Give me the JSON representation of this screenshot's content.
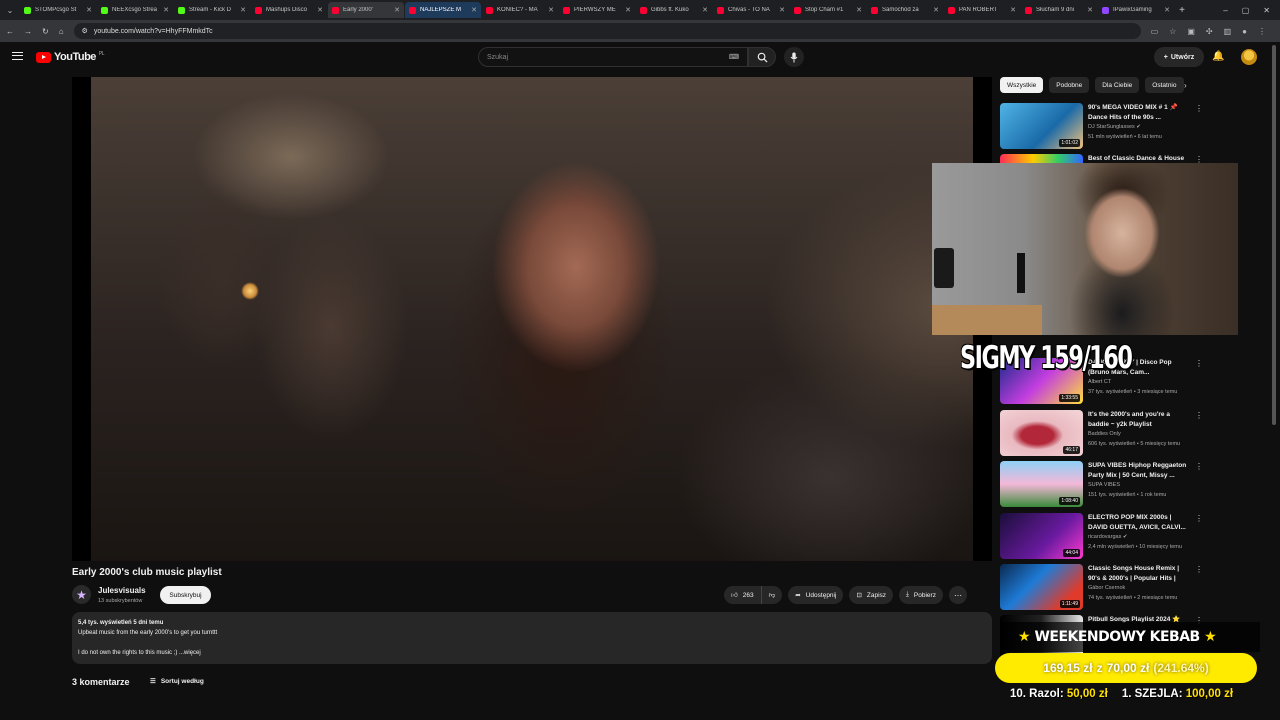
{
  "browser": {
    "tabs": [
      {
        "title": "STOMPcsgo St",
        "favicon_color": "#53fc18"
      },
      {
        "title": "NEEXcsgo Strea",
        "favicon_color": "#53fc18"
      },
      {
        "title": "Stream - Kick D",
        "favicon_color": "#53fc18"
      },
      {
        "title": "Mashups Disco",
        "favicon_color": "#ff0033"
      },
      {
        "title": "Early 2000'",
        "favicon_color": "#ff0033",
        "active": true
      },
      {
        "title": "NAJLEPSZE M",
        "favicon_color": "#ff0033",
        "highlight": true
      },
      {
        "title": "KONIEC? - MA",
        "favicon_color": "#ff0033"
      },
      {
        "title": "PIERWSZY ME",
        "favicon_color": "#ff0033"
      },
      {
        "title": "Gibbs ft. Kuko",
        "favicon_color": "#ff0033"
      },
      {
        "title": "Chivas - TO NA",
        "favicon_color": "#ff0033"
      },
      {
        "title": "Stop Cham #1",
        "favicon_color": "#ff0033"
      },
      {
        "title": "Samochód za",
        "favicon_color": "#ff0033"
      },
      {
        "title": "PAN ROBERT",
        "favicon_color": "#ff0033"
      },
      {
        "title": "Słucham 9 dni",
        "favicon_color": "#ff0033"
      },
      {
        "title": "IPawixGaming",
        "favicon_color": "#9146ff"
      }
    ],
    "url": "youtube.com/watch?v=HhyFFMmkdTc"
  },
  "youtube": {
    "logo_text": "YouTube",
    "logo_country": "PL",
    "search_placeholder": "Szukaj",
    "create_label": "Utwórz"
  },
  "video": {
    "title": "Early 2000's club music playlist",
    "channel_name": "Julesvisuals",
    "channel_subs": "13 subskrybentów",
    "subscribe_label": "Subskrybuj",
    "like_count": "263",
    "share_label": "Udostępnij",
    "save_label": "Zapisz",
    "download_label": "Pobierz",
    "description_stats": "5,4 tys. wyświetleń  5 dni temu",
    "description_line1": "Upbeat music from the early 2000's to get you turnttt",
    "description_line2": "I do not own the rights to this music ;) ...więcej",
    "comments_count": "3 komentarze",
    "sort_label": "Sortuj według"
  },
  "chips": [
    "Wszystkie",
    "Podobne",
    "Dla Ciebie",
    "Ostatnio"
  ],
  "recommendations": [
    {
      "title": "90's MEGA VIDEO MIX # 1 📌 Dance Hits of the 90s ...",
      "channel": "DJ StarSunglasses ✔",
      "meta": "51 mln wyświetleń • 6 lat temu",
      "duration": "1:01:02",
      "thumb": "thumb-a"
    },
    {
      "title": "Best of Classic Dance & House",
      "channel": "",
      "meta": "",
      "duration": "",
      "thumb": "thumb-b"
    },
    {
      "title": "DANCE PARTY | Disco Pop (Bruno Mars, Cam...",
      "channel": "Albert CT",
      "meta": "37 tys. wyświetleń • 3 miesiące temu",
      "duration": "1:33:55",
      "thumb": "thumb-d"
    },
    {
      "title": "It's the 2000's and you're a baddie ~ y2k Playlist",
      "channel": "Baddies Only",
      "meta": "606 tys. wyświetleń • 5 miesięcy temu",
      "duration": "46:17",
      "thumb": "thumb-e"
    },
    {
      "title": "SUPA VIBES Hiphop Reggaeton Party Mix | 50 Cent, Missy ...",
      "channel": "SUPA VIBES",
      "meta": "151 tys. wyświetleń • 1 rok temu",
      "duration": "1:08:40",
      "thumb": "thumb-f"
    },
    {
      "title": "ELECTRO POP MIX 2000s | DAVID GUETTA, AVICII, CALVI...",
      "channel": "ricardovargas ✔",
      "meta": "2,4 mln wyświetleń • 10 miesięcy temu",
      "duration": "44:04",
      "thumb": "thumb-g"
    },
    {
      "title": "Classic Songs House Remix | 90's & 2000's | Popular Hits |",
      "channel": "Gábor Csernok",
      "meta": "74 tys. wyświetleń • 2 miesiące temu",
      "duration": "1:11:49",
      "thumb": "thumb-h"
    },
    {
      "title": "Pitbull Songs Playlist 2024 ⭐",
      "channel": "",
      "meta": "",
      "duration": "",
      "thumb": "thumb-i"
    }
  ],
  "stream_overlay": {
    "sigmy_text": "SIGMY 159/160",
    "kebab_title": "WEEKENDOWY KEBAB",
    "goal_current": "169,15 zł",
    "goal_separator": "z",
    "goal_target": "70,00 zł",
    "goal_percent": "(241.64%)",
    "goal_fraction": 1.0,
    "donor1_label": "10. Razol:",
    "donor1_amount": "50,00 zł",
    "donor2_label": "1. SZEJLA:",
    "donor2_amount": "100,00 zł"
  },
  "colors": {
    "background": "#0f0f0f",
    "accent_red": "#ff0000",
    "goal_yellow": "#ffeb00"
  }
}
